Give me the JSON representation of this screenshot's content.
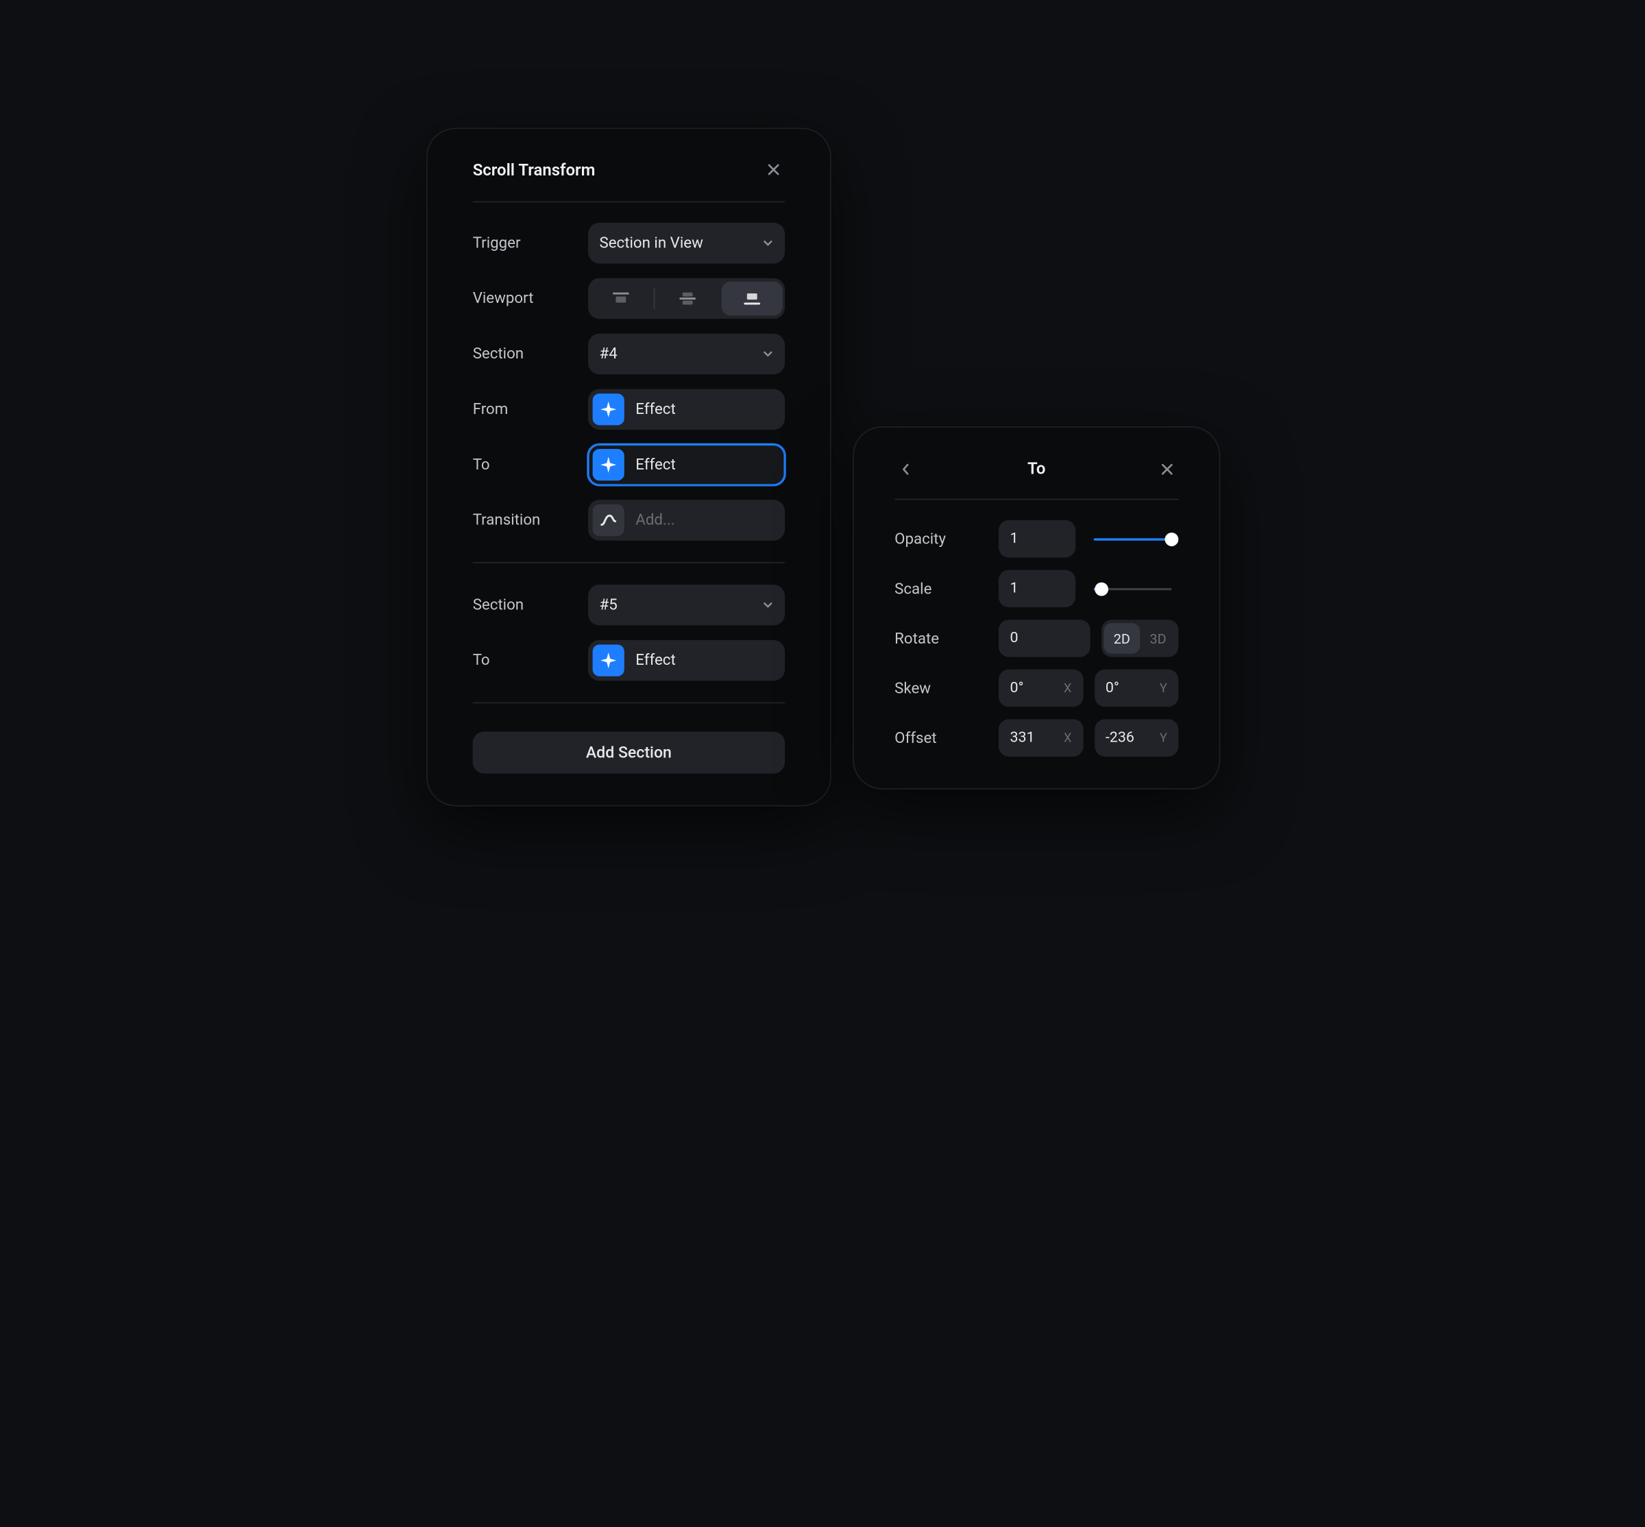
{
  "panelA": {
    "title": "Scroll Transform",
    "labels": {
      "trigger": "Trigger",
      "viewport": "Viewport",
      "section": "Section",
      "from": "From",
      "to": "To",
      "transition": "Transition"
    },
    "trigger": {
      "value": "Section in View"
    },
    "viewport": {
      "selected": "bottom",
      "options": [
        "top",
        "center",
        "bottom"
      ]
    },
    "sections": [
      {
        "id": "#4",
        "from": "Effect",
        "to": "Effect",
        "transition_placeholder": "Add...",
        "to_active": true
      },
      {
        "id": "#5",
        "to": "Effect"
      }
    ],
    "addSection": "Add Section"
  },
  "panelB": {
    "title": "To",
    "labels": {
      "opacity": "Opacity",
      "scale": "Scale",
      "rotate": "Rotate",
      "skew": "Skew",
      "offset": "Offset"
    },
    "opacity": {
      "value": "1",
      "slider": 1.0
    },
    "scale": {
      "value": "1",
      "slider": 0.1
    },
    "rotate": {
      "value": "0",
      "mode": "2D",
      "modes": [
        "2D",
        "3D"
      ]
    },
    "skew": {
      "x": "0°",
      "y": "0°",
      "x_suffix": "X",
      "y_suffix": "Y"
    },
    "offset": {
      "x": "331",
      "y": "-236",
      "x_suffix": "X",
      "y_suffix": "Y"
    }
  },
  "colors": {
    "accent": "#1d7fff",
    "panel": "#0a0b0d",
    "field": "#212328"
  }
}
